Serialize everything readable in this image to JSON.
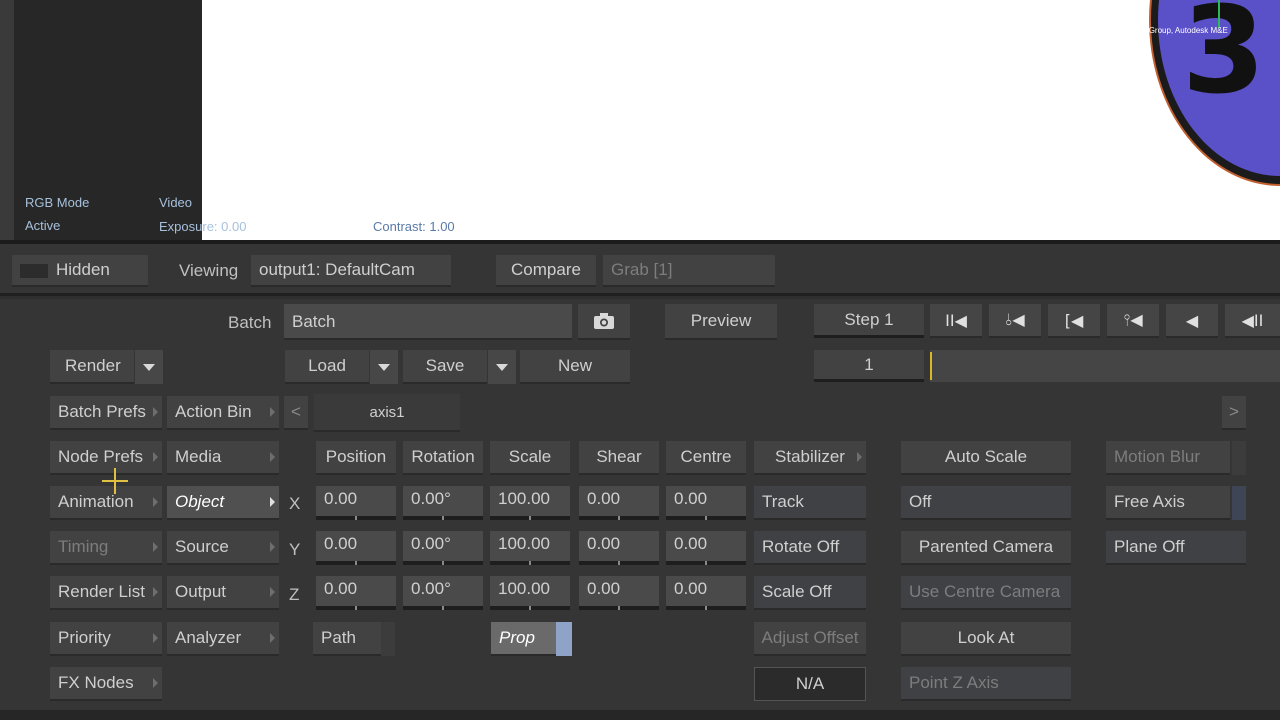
{
  "viewer": {
    "rgb_mode": "RGB Mode",
    "active": "Active",
    "video": "Video",
    "exposure": "Exposure: 0.00",
    "contrast": "Contrast: 1.00",
    "credit": "Courtesy of the WDM Group, Autodesk M&E",
    "logo_digit": "3",
    "logo_color": "#5a50c8"
  },
  "viewer_bar": {
    "hidden": "Hidden",
    "viewing_label": "Viewing",
    "viewing_value": "output1: DefaultCam",
    "compare": "Compare",
    "grab": "Grab [1]"
  },
  "batch": {
    "label": "Batch",
    "name_value": "Batch",
    "snapshot_icon": "camera-icon",
    "preview": "Preview",
    "load": "Load",
    "save": "Save",
    "new": "New",
    "render": "Render"
  },
  "transport": {
    "step": "Step 1",
    "frame": "1",
    "icons": [
      "goto-start-icon",
      "prev-keyframe-icon",
      "prev-mark-icon",
      "prev-key-icon",
      "play-backward-icon",
      "step-back-icon"
    ]
  },
  "menu_left": [
    "Batch Prefs",
    "Node Prefs",
    "Animation",
    "Timing",
    "Render List",
    "Priority",
    "FX Nodes"
  ],
  "menu_right": [
    "Action Bin",
    "Media",
    "Object",
    "Source",
    "Output",
    "Analyzer"
  ],
  "tab": {
    "prev": "<",
    "name": "axis1",
    "next": ">"
  },
  "axis": {
    "headers": [
      "Position",
      "Rotation",
      "Scale",
      "Shear",
      "Centre"
    ],
    "rows": [
      {
        "axis": "X",
        "position": "0.00",
        "rotation": "0.00°",
        "scale": "100.00",
        "shear": "0.00",
        "centre": "0.00"
      },
      {
        "axis": "Y",
        "position": "0.00",
        "rotation": "0.00°",
        "scale": "100.00",
        "shear": "0.00",
        "centre": "0.00"
      },
      {
        "axis": "Z",
        "position": "0.00",
        "rotation": "0.00°",
        "scale": "100.00",
        "shear": "0.00",
        "centre": "0.00"
      }
    ],
    "path": "Path",
    "prop": "Prop"
  },
  "stabilizer": {
    "title": "Stabilizer",
    "track": "Track",
    "rotate": "Rotate Off",
    "scale": "Scale Off",
    "adjust": "Adjust Offset",
    "na": "N/A"
  },
  "camera": {
    "auto_scale": "Auto Scale",
    "off": "Off",
    "parented": "Parented Camera",
    "use_centre": "Use Centre Camera",
    "look_at": "Look At",
    "point_z": "Point Z Axis"
  },
  "extra": {
    "motion_blur": "Motion Blur",
    "free_axis": "Free Axis",
    "plane_off": "Plane Off"
  }
}
